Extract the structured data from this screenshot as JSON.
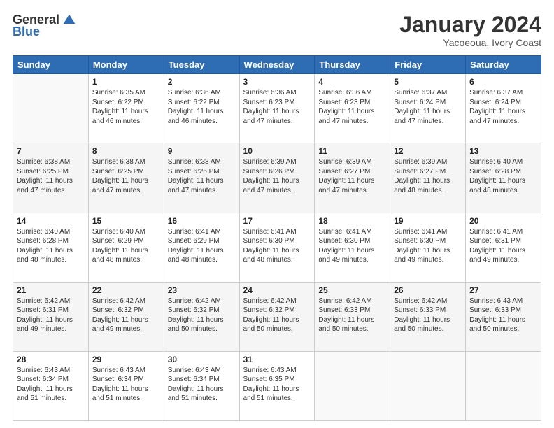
{
  "logo": {
    "general": "General",
    "blue": "Blue"
  },
  "header": {
    "month": "January 2024",
    "location": "Yacoeoua, Ivory Coast"
  },
  "weekdays": [
    "Sunday",
    "Monday",
    "Tuesday",
    "Wednesday",
    "Thursday",
    "Friday",
    "Saturday"
  ],
  "weeks": [
    [
      {
        "day": "",
        "text": ""
      },
      {
        "day": "1",
        "text": "Sunrise: 6:35 AM\nSunset: 6:22 PM\nDaylight: 11 hours\nand 46 minutes."
      },
      {
        "day": "2",
        "text": "Sunrise: 6:36 AM\nSunset: 6:22 PM\nDaylight: 11 hours\nand 46 minutes."
      },
      {
        "day": "3",
        "text": "Sunrise: 6:36 AM\nSunset: 6:23 PM\nDaylight: 11 hours\nand 47 minutes."
      },
      {
        "day": "4",
        "text": "Sunrise: 6:36 AM\nSunset: 6:23 PM\nDaylight: 11 hours\nand 47 minutes."
      },
      {
        "day": "5",
        "text": "Sunrise: 6:37 AM\nSunset: 6:24 PM\nDaylight: 11 hours\nand 47 minutes."
      },
      {
        "day": "6",
        "text": "Sunrise: 6:37 AM\nSunset: 6:24 PM\nDaylight: 11 hours\nand 47 minutes."
      }
    ],
    [
      {
        "day": "7",
        "text": "Sunrise: 6:38 AM\nSunset: 6:25 PM\nDaylight: 11 hours\nand 47 minutes."
      },
      {
        "day": "8",
        "text": "Sunrise: 6:38 AM\nSunset: 6:25 PM\nDaylight: 11 hours\nand 47 minutes."
      },
      {
        "day": "9",
        "text": "Sunrise: 6:38 AM\nSunset: 6:26 PM\nDaylight: 11 hours\nand 47 minutes."
      },
      {
        "day": "10",
        "text": "Sunrise: 6:39 AM\nSunset: 6:26 PM\nDaylight: 11 hours\nand 47 minutes."
      },
      {
        "day": "11",
        "text": "Sunrise: 6:39 AM\nSunset: 6:27 PM\nDaylight: 11 hours\nand 47 minutes."
      },
      {
        "day": "12",
        "text": "Sunrise: 6:39 AM\nSunset: 6:27 PM\nDaylight: 11 hours\nand 48 minutes."
      },
      {
        "day": "13",
        "text": "Sunrise: 6:40 AM\nSunset: 6:28 PM\nDaylight: 11 hours\nand 48 minutes."
      }
    ],
    [
      {
        "day": "14",
        "text": "Sunrise: 6:40 AM\nSunset: 6:28 PM\nDaylight: 11 hours\nand 48 minutes."
      },
      {
        "day": "15",
        "text": "Sunrise: 6:40 AM\nSunset: 6:29 PM\nDaylight: 11 hours\nand 48 minutes."
      },
      {
        "day": "16",
        "text": "Sunrise: 6:41 AM\nSunset: 6:29 PM\nDaylight: 11 hours\nand 48 minutes."
      },
      {
        "day": "17",
        "text": "Sunrise: 6:41 AM\nSunset: 6:30 PM\nDaylight: 11 hours\nand 48 minutes."
      },
      {
        "day": "18",
        "text": "Sunrise: 6:41 AM\nSunset: 6:30 PM\nDaylight: 11 hours\nand 49 minutes."
      },
      {
        "day": "19",
        "text": "Sunrise: 6:41 AM\nSunset: 6:30 PM\nDaylight: 11 hours\nand 49 minutes."
      },
      {
        "day": "20",
        "text": "Sunrise: 6:41 AM\nSunset: 6:31 PM\nDaylight: 11 hours\nand 49 minutes."
      }
    ],
    [
      {
        "day": "21",
        "text": "Sunrise: 6:42 AM\nSunset: 6:31 PM\nDaylight: 11 hours\nand 49 minutes."
      },
      {
        "day": "22",
        "text": "Sunrise: 6:42 AM\nSunset: 6:32 PM\nDaylight: 11 hours\nand 49 minutes."
      },
      {
        "day": "23",
        "text": "Sunrise: 6:42 AM\nSunset: 6:32 PM\nDaylight: 11 hours\nand 50 minutes."
      },
      {
        "day": "24",
        "text": "Sunrise: 6:42 AM\nSunset: 6:32 PM\nDaylight: 11 hours\nand 50 minutes."
      },
      {
        "day": "25",
        "text": "Sunrise: 6:42 AM\nSunset: 6:33 PM\nDaylight: 11 hours\nand 50 minutes."
      },
      {
        "day": "26",
        "text": "Sunrise: 6:42 AM\nSunset: 6:33 PM\nDaylight: 11 hours\nand 50 minutes."
      },
      {
        "day": "27",
        "text": "Sunrise: 6:43 AM\nSunset: 6:33 PM\nDaylight: 11 hours\nand 50 minutes."
      }
    ],
    [
      {
        "day": "28",
        "text": "Sunrise: 6:43 AM\nSunset: 6:34 PM\nDaylight: 11 hours\nand 51 minutes."
      },
      {
        "day": "29",
        "text": "Sunrise: 6:43 AM\nSunset: 6:34 PM\nDaylight: 11 hours\nand 51 minutes."
      },
      {
        "day": "30",
        "text": "Sunrise: 6:43 AM\nSunset: 6:34 PM\nDaylight: 11 hours\nand 51 minutes."
      },
      {
        "day": "31",
        "text": "Sunrise: 6:43 AM\nSunset: 6:35 PM\nDaylight: 11 hours\nand 51 minutes."
      },
      {
        "day": "",
        "text": ""
      },
      {
        "day": "",
        "text": ""
      },
      {
        "day": "",
        "text": ""
      }
    ]
  ]
}
